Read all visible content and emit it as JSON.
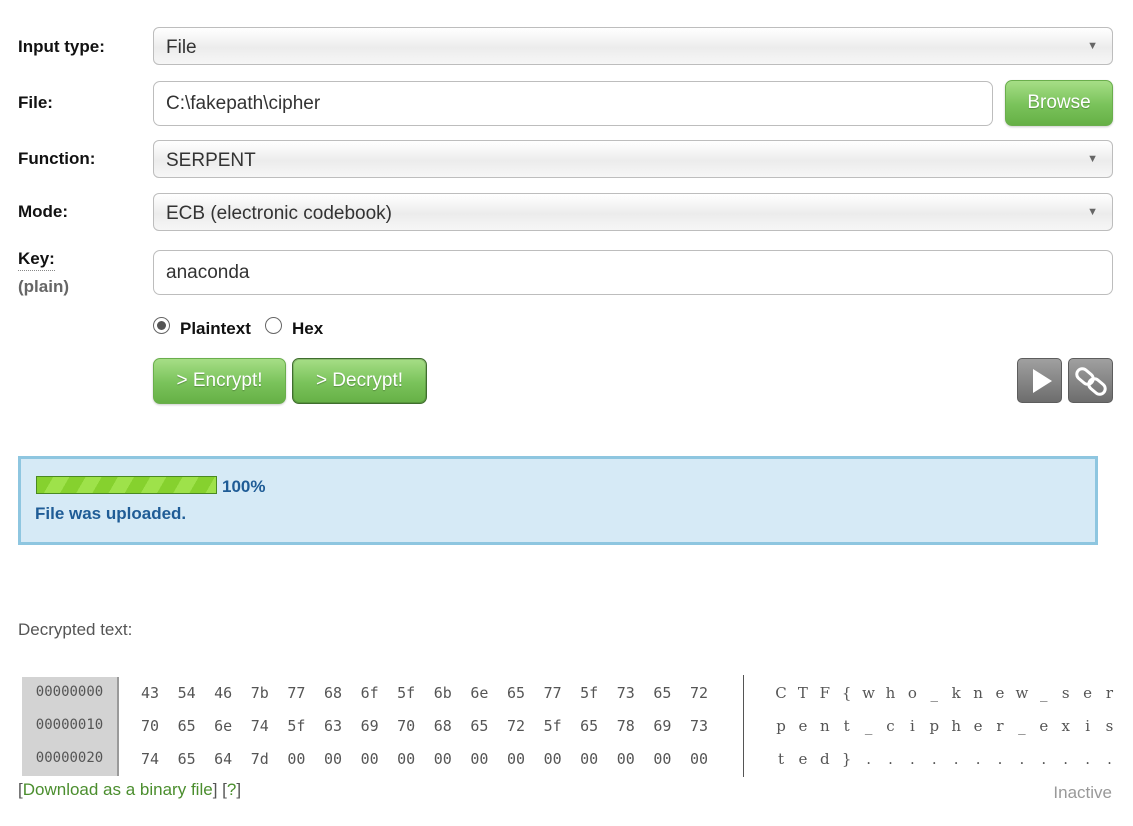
{
  "form": {
    "input_type": {
      "label": "Input type:",
      "value": "File"
    },
    "file": {
      "label": "File:",
      "value": "C:\\fakepath\\cipher",
      "browse_label": "Browse"
    },
    "function": {
      "label": "Function:",
      "value": "SERPENT"
    },
    "mode": {
      "label": "Mode:",
      "value": "ECB (electronic codebook)"
    },
    "key": {
      "label": "Key:",
      "sublabel": "(plain)",
      "value": "anaconda"
    },
    "key_format": {
      "options": [
        {
          "label": "Plaintext",
          "selected": true
        },
        {
          "label": "Hex",
          "selected": false
        }
      ]
    },
    "encrypt_label": "> Encrypt!",
    "decrypt_label": "> Decrypt!",
    "icons": [
      "play-icon",
      "link-icon"
    ]
  },
  "status": {
    "progress_percent": 100,
    "progress_text": "100%",
    "message": "File was uploaded.",
    "colors": {
      "text": "#1f5c96",
      "background": "#d6eaf6",
      "border": "#8ec6e0"
    }
  },
  "output": {
    "label": "Decrypted text:",
    "rows": [
      {
        "offset": "00000000",
        "bytes": [
          "43",
          "54",
          "46",
          "7b",
          "77",
          "68",
          "6f",
          "5f",
          "6b",
          "6e",
          "65",
          "77",
          "5f",
          "73",
          "65",
          "72"
        ],
        "ascii": [
          "C",
          "T",
          "F",
          "{",
          "w",
          "h",
          "o",
          "_",
          "k",
          "n",
          "e",
          "w",
          "_",
          "s",
          "e",
          "r"
        ]
      },
      {
        "offset": "00000010",
        "bytes": [
          "70",
          "65",
          "6e",
          "74",
          "5f",
          "63",
          "69",
          "70",
          "68",
          "65",
          "72",
          "5f",
          "65",
          "78",
          "69",
          "73"
        ],
        "ascii": [
          "p",
          "e",
          "n",
          "t",
          "_",
          "c",
          "i",
          "p",
          "h",
          "e",
          "r",
          "_",
          "e",
          "x",
          "i",
          "s"
        ]
      },
      {
        "offset": "00000020",
        "bytes": [
          "74",
          "65",
          "64",
          "7d",
          "00",
          "00",
          "00",
          "00",
          "00",
          "00",
          "00",
          "00",
          "00",
          "00",
          "00",
          "00"
        ],
        "ascii": [
          "t",
          "e",
          "d",
          "}",
          ".",
          ".",
          ".",
          ".",
          ".",
          ".",
          ".",
          ".",
          ".",
          ".",
          ".",
          "."
        ]
      }
    ],
    "download": {
      "open_bracket": "[",
      "link_text": "Download as a binary file",
      "mid_text": "] [",
      "help_text": "?",
      "close_bracket": "]"
    },
    "state": "Inactive"
  }
}
